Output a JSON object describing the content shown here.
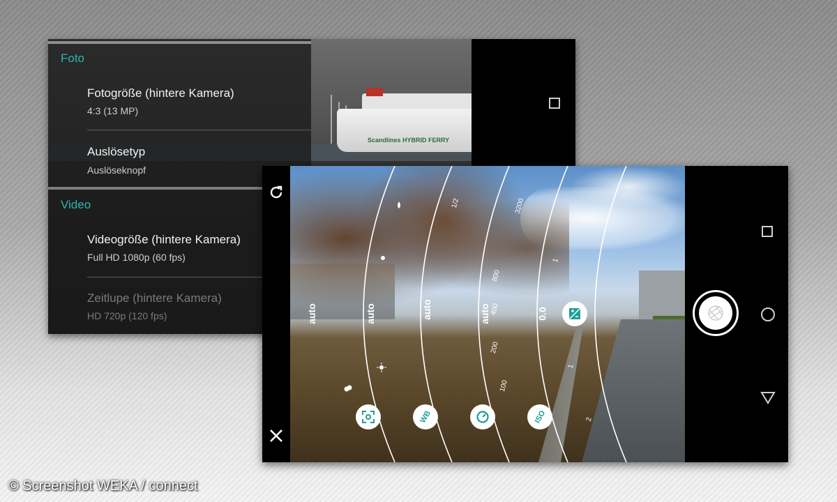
{
  "settings": {
    "sections": [
      {
        "header": "Foto",
        "items": [
          {
            "title": "Fotogröße (hintere Kamera)",
            "subtitle": "4:3 (13 MP)"
          },
          {
            "title": "Auslösetyp",
            "subtitle": "Auslöseknopf"
          }
        ]
      },
      {
        "header": "Video",
        "items": [
          {
            "title": "Videogröße (hintere Kamera)",
            "subtitle": "Full HD 1080p (60 fps)"
          },
          {
            "title": "Zeitlupe (hintere Kamera)",
            "subtitle": "HD 720p (120 fps)",
            "disabled": true
          }
        ]
      }
    ],
    "ferry_label": "Scandlines HYBRID FERRY"
  },
  "camera": {
    "manual_values": [
      "auto",
      "auto",
      "auto",
      "auto",
      "0.0"
    ],
    "dial_ticks": [
      "100",
      "200",
      "400",
      "800",
      "3200",
      "1/2",
      "1",
      "1",
      "2"
    ],
    "mode_buttons": [
      {
        "icon": "focus-icon",
        "label": ""
      },
      {
        "icon": "white-balance-icon",
        "label": "WB"
      },
      {
        "icon": "shutter-speed-icon",
        "label": ""
      },
      {
        "icon": "iso-icon",
        "label": "ISO"
      }
    ],
    "exposure_icon": "exposure-icon"
  },
  "navigation": {
    "icons": [
      "recent-apps-icon",
      "home-icon",
      "back-icon"
    ]
  },
  "colors": {
    "accent": "#2bb6b0",
    "button_fg": "#1e9f98"
  },
  "watermark": "© Screenshot WEKA / connect"
}
